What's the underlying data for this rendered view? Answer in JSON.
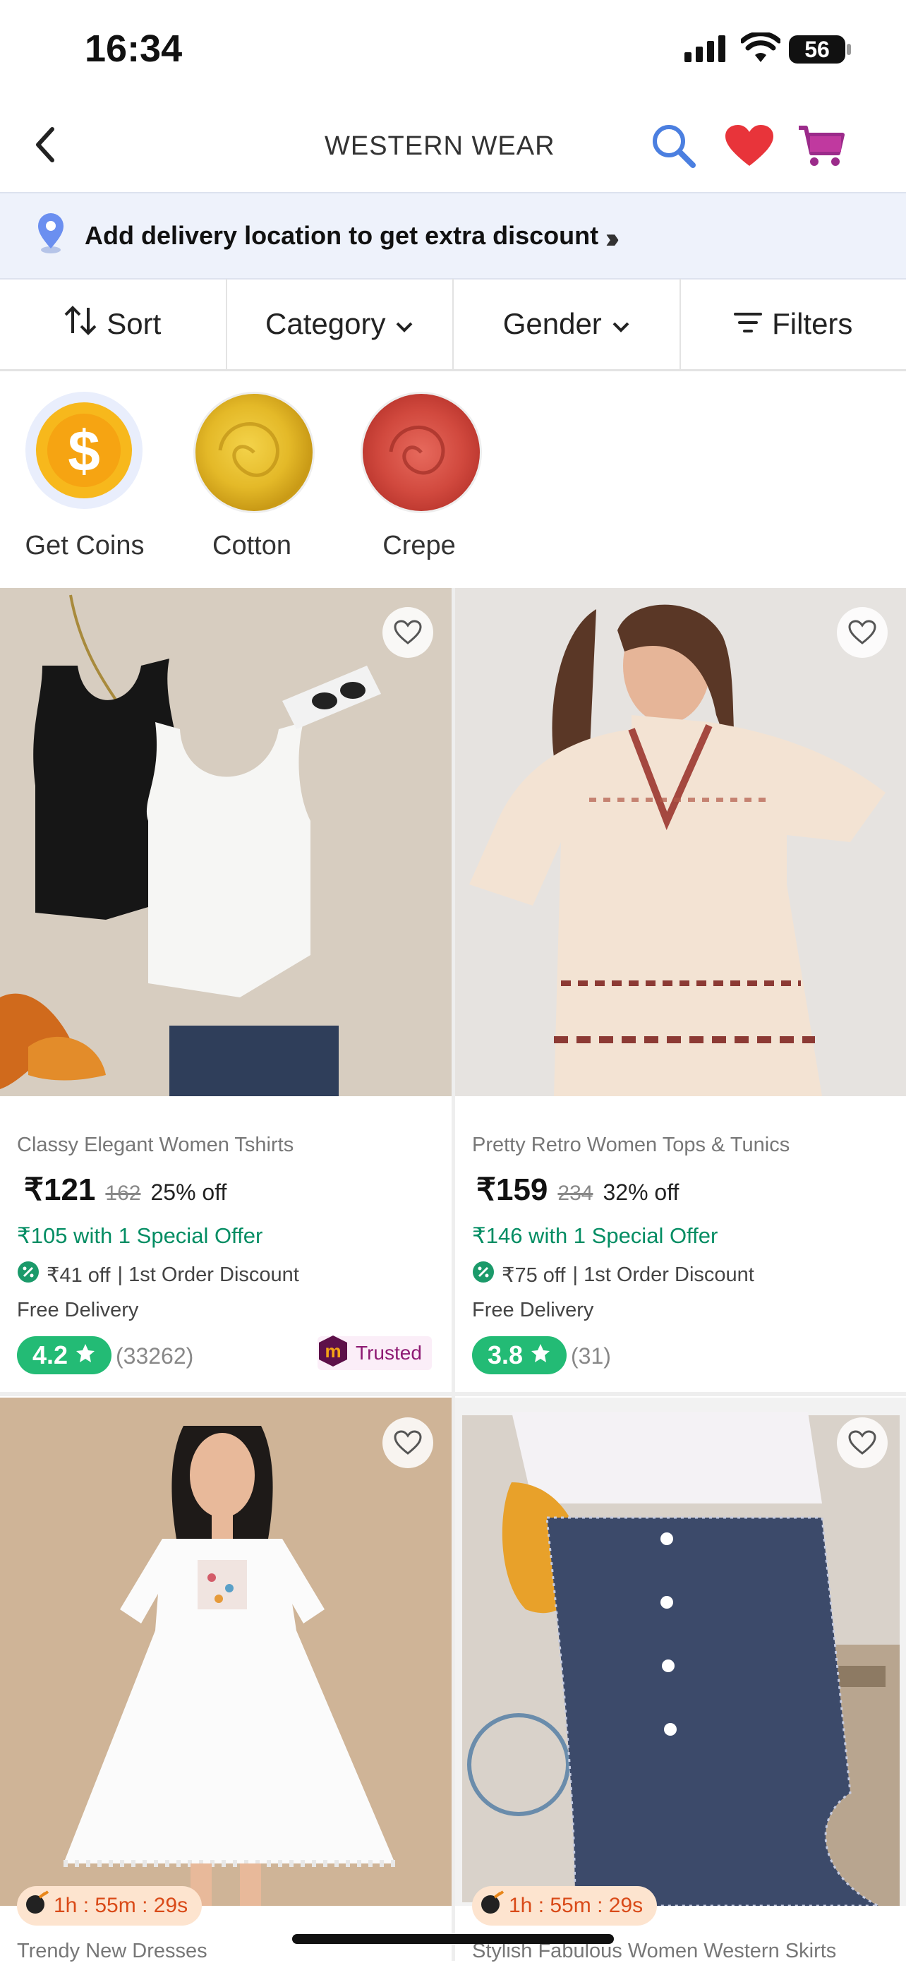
{
  "status_bar": {
    "time": "16:34",
    "battery": "56"
  },
  "header": {
    "title": "WESTERN WEAR"
  },
  "banner": {
    "text": "Add delivery location to get extra discount"
  },
  "filters": [
    {
      "label": "Sort",
      "icon": "sort-icon"
    },
    {
      "label": "Category",
      "icon": "chevron-down-icon"
    },
    {
      "label": "Gender",
      "icon": "chevron-down-icon"
    },
    {
      "label": "Filters",
      "icon": "filter-icon"
    }
  ],
  "chips": [
    {
      "label": "Get Coins"
    },
    {
      "label": "Cotton"
    },
    {
      "label": "Crepe"
    }
  ],
  "products": [
    {
      "name": "Classy Elegant Women Tshirts",
      "price": "₹121",
      "mrp": "162",
      "discount": "25% off",
      "special_offer": "₹105 with 1 Special Offer",
      "first_order_amount": "₹41 off",
      "first_order_text": "| 1st Order Discount",
      "delivery": "Free Delivery",
      "rating": "4.2",
      "rating_count": "(33262)",
      "badge": "Trusted"
    },
    {
      "name": "Pretty Retro Women Tops & Tunics",
      "price": "₹159",
      "mrp": "234",
      "discount": "32% off",
      "special_offer": "₹146 with 1 Special Offer",
      "first_order_amount": "₹75 off",
      "first_order_text": "| 1st Order Discount",
      "delivery": "Free Delivery",
      "rating": "3.8",
      "rating_count": "(31)"
    },
    {
      "name": "Trendy New Dresses",
      "timer": "1h : 55m : 29s"
    },
    {
      "name": "Stylish Fabulous Women Western Skirts",
      "timer": "1h : 55m : 29s"
    }
  ],
  "colors": {
    "accent_green": "#038d63",
    "rating_green": "#23bb75",
    "brand_purple": "#9b2b8a",
    "heart_red": "#e8343a",
    "search_blue": "#4b7fe0"
  }
}
